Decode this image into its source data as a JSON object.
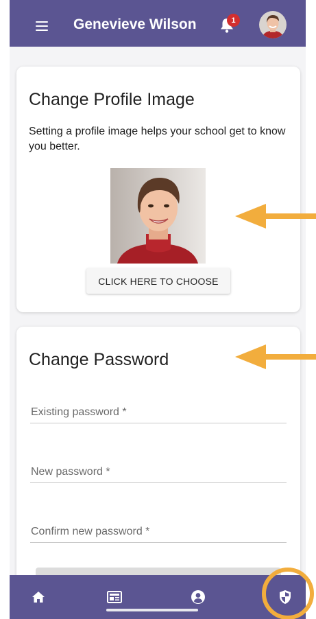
{
  "header": {
    "user_name": "Genevieve Wilson",
    "notification_count": "1",
    "menu_icon": "menu-icon",
    "bell_icon": "bell-icon"
  },
  "profile_card": {
    "title": "Change Profile Image",
    "description": "Setting a profile image helps your school get to know you better.",
    "choose_button": "CLICK HERE TO CHOOSE"
  },
  "password_card": {
    "title": "Change Password",
    "fields": [
      {
        "label": "Existing password *"
      },
      {
        "label": "New password *"
      },
      {
        "label": "Confirm new password *"
      }
    ]
  },
  "bottom_nav": {
    "items": [
      {
        "icon": "home-icon"
      },
      {
        "icon": "news-icon"
      },
      {
        "icon": "account-icon"
      },
      {
        "icon": "shield-icon"
      }
    ]
  },
  "colors": {
    "brand": "#5b5592",
    "badge": "#d32f2f",
    "annotation": "#f2ad3d"
  }
}
